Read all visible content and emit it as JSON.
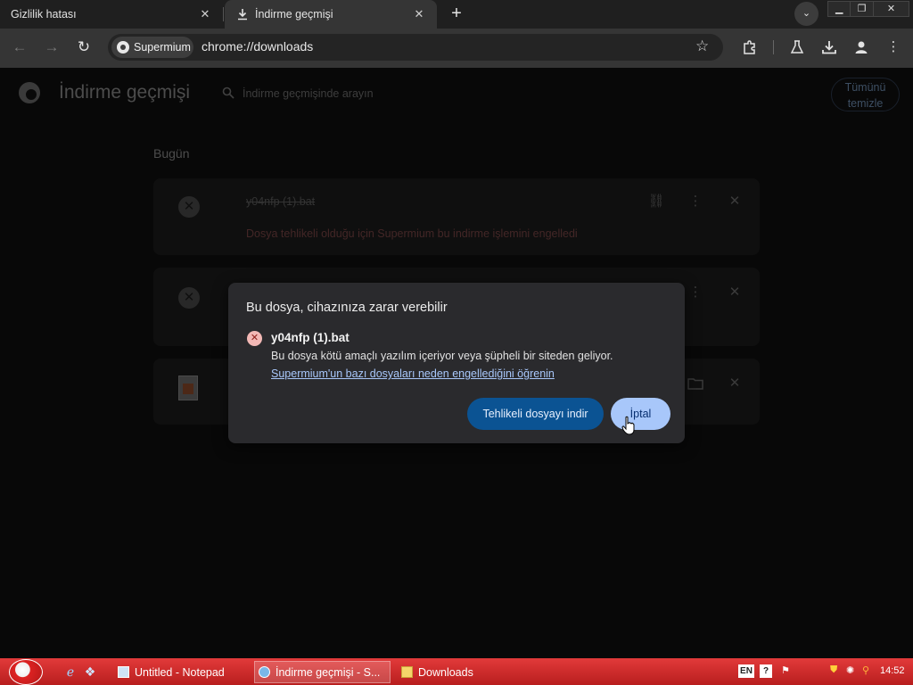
{
  "browser": {
    "tabs": [
      {
        "label": "Gizlilik hatası"
      },
      {
        "label": "İndirme geçmişi"
      }
    ],
    "tab_close_glyph": "✕",
    "new_tab_glyph": "+",
    "tab_search_glyph": "⌄",
    "window_controls": {
      "minimize": "▁",
      "restore": "❐",
      "close": "✕"
    },
    "site_chip": "Supermium",
    "url": "chrome://downloads"
  },
  "downloads_page": {
    "title": "İndirme geçmişi",
    "search_placeholder": "İndirme geçmişinde arayın",
    "clear_all_label": "Tümünü temizle",
    "section_label": "Bugün",
    "items": [
      {
        "filename": "y04nfp (1).bat",
        "status": "Dosya tehlikeli olduğu için Supermium bu indirme işlemini engelledi"
      }
    ]
  },
  "dialog": {
    "title": "Bu dosya, cihazınıza zarar verebilir",
    "filename": "y04nfp (1).bat",
    "description": "Bu dosya kötü amaçlı yazılım içeriyor veya şüpheli bir siteden geliyor.",
    "link_text": "Supermium'un bazı dosyaları neden engellediğini öğrenin",
    "download_dangerous_label": "Tehlikeli dosyayı indir",
    "cancel_label": "İptal"
  },
  "taskbar": {
    "tasks": [
      {
        "label": "Untitled - Notepad"
      },
      {
        "label": "İndirme geçmişi - S..."
      },
      {
        "label": "Downloads"
      }
    ],
    "language": "EN",
    "help_glyph": "?",
    "clock": "14:52"
  },
  "colors": {
    "accent_button": "#0b5393",
    "cancel_button": "#a8c7fa",
    "taskbar": "#c92424",
    "danger_text": "#7a4646"
  }
}
